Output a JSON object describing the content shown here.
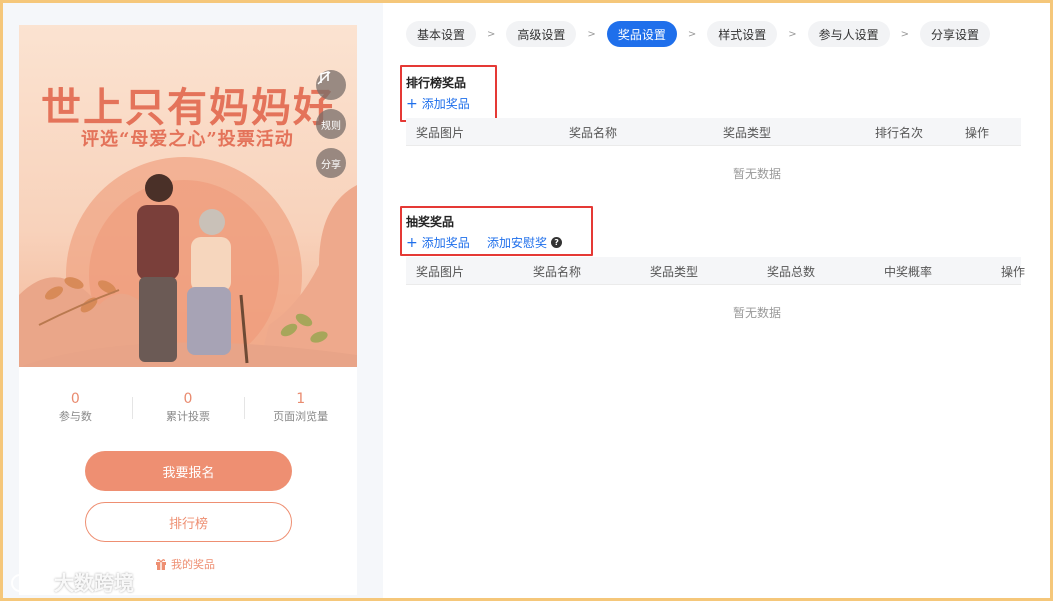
{
  "preview": {
    "poster_title": "世上只有妈妈好",
    "poster_subtitle": "评选“母爱之心”投票活动",
    "side_buttons": {
      "music_icon": "music-icon",
      "rules_label": "规则",
      "share_label": "分享"
    },
    "stats": [
      {
        "value": "0",
        "label": "参与数"
      },
      {
        "value": "0",
        "label": "累计投票"
      },
      {
        "value": "1",
        "label": "页面浏览量"
      }
    ],
    "signup_label": "我要报名",
    "ranking_label": "排行榜",
    "my_prize_label": "我的奖品",
    "watermark": "大数跨境"
  },
  "steps": [
    {
      "label": "基本设置",
      "active": false
    },
    {
      "label": "高级设置",
      "active": false
    },
    {
      "label": "奖品设置",
      "active": true
    },
    {
      "label": "样式设置",
      "active": false
    },
    {
      "label": "参与人设置",
      "active": false
    },
    {
      "label": "分享设置",
      "active": false
    }
  ],
  "step_separator": ">",
  "ranking_prizes": {
    "title": "排行榜奖品",
    "add_label": "添加奖品",
    "columns": [
      "奖品图片",
      "奖品名称",
      "奖品类型",
      "排行名次",
      "操作"
    ],
    "empty_text": "暂无数据"
  },
  "lottery_prizes": {
    "title": "抽奖奖品",
    "add_label": "添加奖品",
    "add_consolation_label": "添加安慰奖",
    "columns": [
      "奖品图片",
      "奖品名称",
      "奖品类型",
      "奖品总数",
      "中奖概率",
      "操作"
    ],
    "empty_text": "暂无数据"
  },
  "colors": {
    "accent": "#1f6feb",
    "poster_orange": "#e4735a",
    "button_orange": "#ee8f72",
    "highlight_red": "#e53935"
  }
}
